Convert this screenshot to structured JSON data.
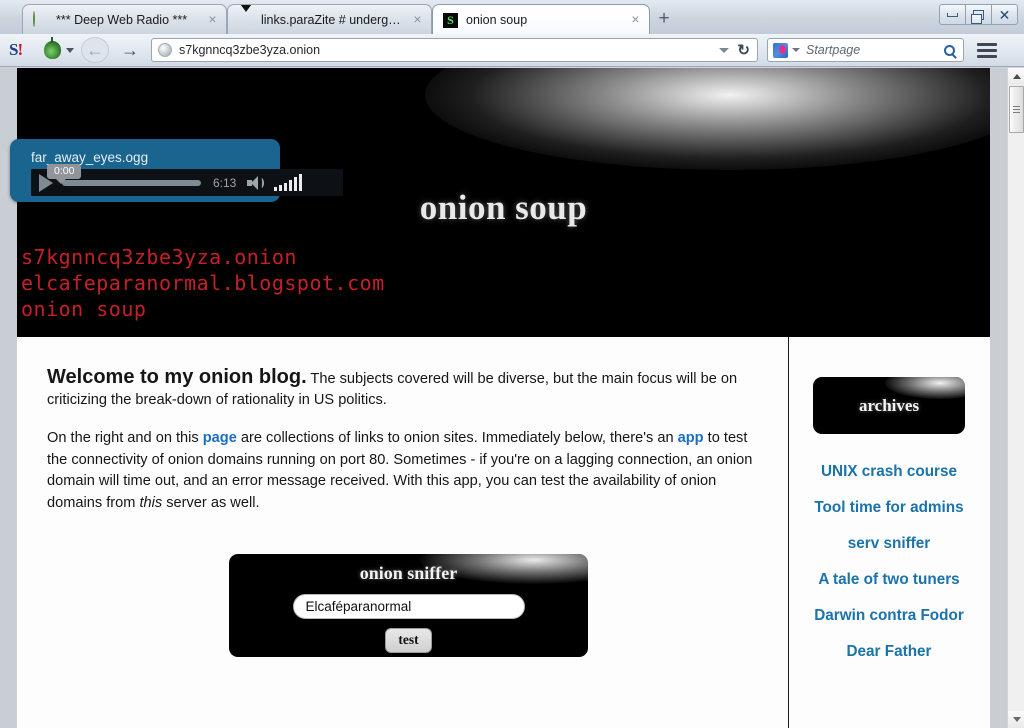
{
  "browser": {
    "tabs": [
      {
        "title": "*** Deep Web Radio ***",
        "icon": "globe-icon",
        "active": false,
        "close": "×"
      },
      {
        "title": "links.paraZite # undergrou...",
        "icon": "triangle-icon",
        "active": false,
        "close": "×"
      },
      {
        "title": "onion soup",
        "icon": "s-favicon",
        "active": true,
        "close": "×"
      }
    ],
    "new_tab_label": "+",
    "window_controls": {
      "minimize": "minimize-icon",
      "maximize": "restore-icon",
      "close": "✕"
    },
    "toolbar": {
      "slashdot_logo": "S",
      "slashdot_logo_ex": "!",
      "tor_icon": "onion-icon",
      "back_label": "←",
      "forward_label": "→",
      "url_value": "s7kgnncq3zbe3yza.onion",
      "reload_label": "↻",
      "search_placeholder": "Startpage",
      "search_engine": "Startpage"
    }
  },
  "audio_player": {
    "filename": "far_away_eyes.ogg",
    "current_time": "0:00",
    "duration": "6:13",
    "volume_bars": [
      4,
      6,
      8,
      11,
      14,
      17
    ]
  },
  "page": {
    "banner": {
      "title": "onion soup",
      "lines": [
        "s7kgnncq3zbe3yza.onion",
        "elcafeparanormal.blogspot.com",
        "onion soup"
      ]
    },
    "main": {
      "lead_strong": "Welcome to my onion blog.",
      "lead_rest": " The subjects covered will be diverse, but the main focus will be on criticizing the break-down of rationality in US politics.",
      "para_1": "On the right and on this ",
      "para_link_1": "page",
      "para_2": " are collections of links to onion sites. Immediately below, there's an ",
      "para_link_2": "app",
      "para_3": " to test the connectivity of onion domains running on port 80. Sometimes - if you're on a lagging connection, an onion domain will time out, and an error message received. With this app, you can test the availability of onion domains from ",
      "para_em": "this",
      "para_4": " server as well."
    },
    "sniffer": {
      "title": "onion sniffer",
      "input_value": "Elcaféparanormal",
      "input_placeholder": "",
      "button_label": "test"
    },
    "sidebar": {
      "archives_label": "archives",
      "links": [
        "UNIX crash course",
        "Tool time for admins",
        "serv sniffer",
        "A tale of two tuners",
        "Darwin contra Fodor",
        "Dear Father"
      ]
    }
  },
  "colors": {
    "banner_bg": "#000000",
    "banner_text_red": "#c42027",
    "link_blue": "#1b73ab",
    "body_link_blue": "#1a6fc4",
    "player_blue": "#1a6490"
  }
}
